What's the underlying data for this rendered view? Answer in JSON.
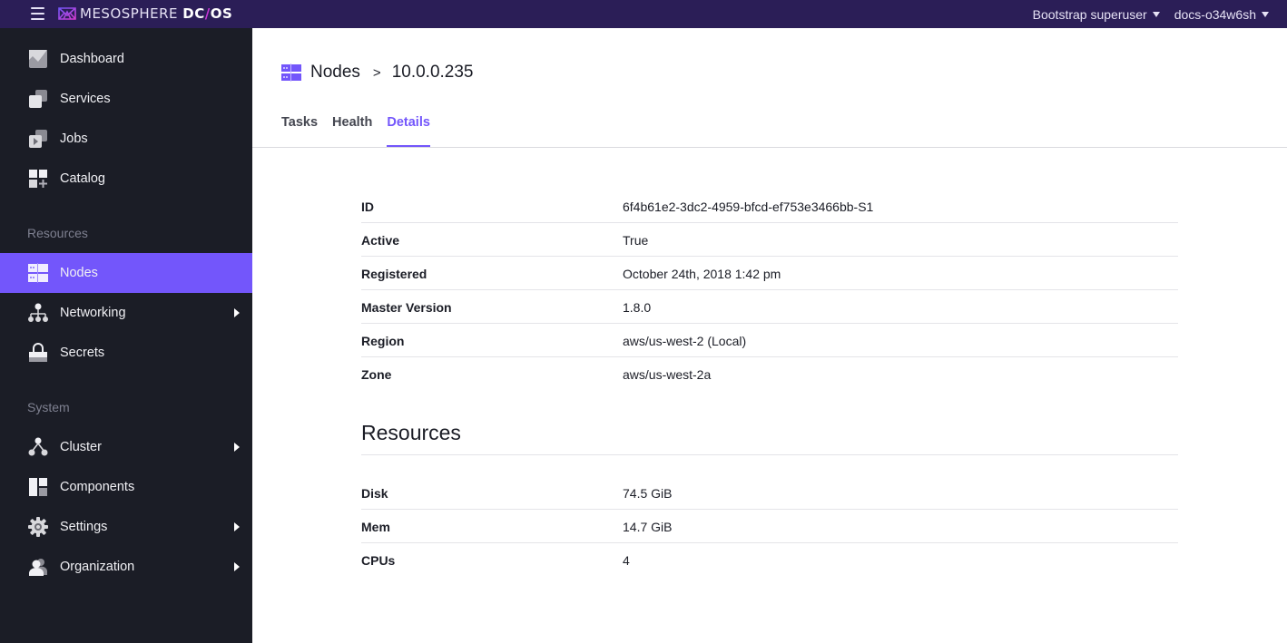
{
  "header": {
    "brand": "MESOSPHERE",
    "product_a": "DC",
    "product_slash": "/",
    "product_b": "OS",
    "user_menu": "Bootstrap superuser",
    "cluster_menu": "docs-o34w6sh"
  },
  "sidebar": {
    "items": [
      {
        "label": "Dashboard",
        "icon": "dashboard-icon"
      },
      {
        "label": "Services",
        "icon": "services-icon"
      },
      {
        "label": "Jobs",
        "icon": "jobs-icon"
      },
      {
        "label": "Catalog",
        "icon": "catalog-icon"
      }
    ],
    "resources_label": "Resources",
    "resources": [
      {
        "label": "Nodes",
        "icon": "nodes-icon",
        "active": true
      },
      {
        "label": "Networking",
        "icon": "networking-icon",
        "has_submenu": true
      },
      {
        "label": "Secrets",
        "icon": "lock-icon"
      }
    ],
    "system_label": "System",
    "system": [
      {
        "label": "Cluster",
        "icon": "cluster-icon",
        "has_submenu": true
      },
      {
        "label": "Components",
        "icon": "components-icon"
      },
      {
        "label": "Settings",
        "icon": "gear-icon",
        "has_submenu": true
      },
      {
        "label": "Organization",
        "icon": "organization-icon",
        "has_submenu": true
      }
    ]
  },
  "breadcrumb": {
    "parent": "Nodes",
    "separator": ">",
    "current": "10.0.0.235"
  },
  "tabs": [
    {
      "label": "Tasks"
    },
    {
      "label": "Health"
    },
    {
      "label": "Details",
      "active": true
    }
  ],
  "details": [
    {
      "key": "ID",
      "value": "6f4b61e2-3dc2-4959-bfcd-ef753e3466bb-S1"
    },
    {
      "key": "Active",
      "value": "True"
    },
    {
      "key": "Registered",
      "value": "October 24th, 2018 1:42 pm"
    },
    {
      "key": "Master Version",
      "value": "1.8.0"
    },
    {
      "key": "Region",
      "value": "aws/us-west-2 (Local)"
    },
    {
      "key": "Zone",
      "value": "aws/us-west-2a"
    }
  ],
  "resources": {
    "heading": "Resources",
    "rows": [
      {
        "key": "Disk",
        "value": "74.5 GiB"
      },
      {
        "key": "Mem",
        "value": "14.7 GiB"
      },
      {
        "key": "CPUs",
        "value": "4"
      }
    ]
  },
  "colors": {
    "topbar": "#2b1e57",
    "sidebar": "#1b1d26",
    "accent": "#7356fb"
  }
}
